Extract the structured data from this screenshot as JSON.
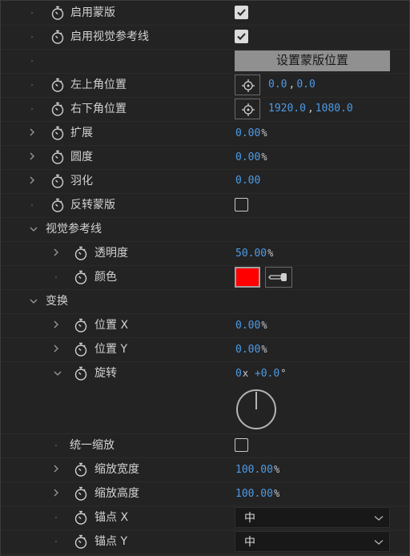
{
  "rows": [
    {
      "label": "启用蒙版",
      "checked": true
    },
    {
      "label": "启用视觉参考线",
      "checked": true
    },
    {
      "button_label": "设置蒙版位置"
    },
    {
      "label": "左上角位置",
      "x": "0.0",
      "y": "0.0"
    },
    {
      "label": "右下角位置",
      "x": "1920.0",
      "y": "1080.0"
    },
    {
      "label": "扩展",
      "value": "0.00",
      "unit": "%"
    },
    {
      "label": "圆度",
      "value": "0.00",
      "unit": "%"
    },
    {
      "label": "羽化",
      "value": "0.00"
    },
    {
      "label": "反转蒙版",
      "checked": false
    },
    {
      "label": "视觉参考线"
    },
    {
      "label": "透明度",
      "value": "50.00",
      "unit": "%"
    },
    {
      "label": "颜色",
      "color": "#ff0000"
    },
    {
      "label": "变换"
    },
    {
      "label": "位置 X",
      "value": "0.00",
      "unit": "%"
    },
    {
      "label": "位置 Y",
      "value": "0.00",
      "unit": "%"
    },
    {
      "label": "旋转",
      "turns": "0",
      "turns_unit": "x",
      "degrees": "+0.0",
      "degrees_unit": "°"
    },
    {
      "label": "统一缩放",
      "checked": false
    },
    {
      "label": "缩放宽度",
      "value": "100.00",
      "unit": "%"
    },
    {
      "label": "缩放高度",
      "value": "100.00",
      "unit": "%"
    },
    {
      "label": "锚点 X",
      "selected": "中"
    },
    {
      "label": "锚点 Y",
      "selected": "中"
    }
  ],
  "icons": {
    "stopwatch": "stopwatch-icon",
    "expand": "chevron-right-icon",
    "collapse": "chevron-down-icon",
    "target": "crosshair-icon",
    "eyedropper": "eyedropper-icon"
  },
  "colors": {
    "value_blue": "#4d9be6",
    "swatch_red": "#ff0000",
    "background": "#232323"
  }
}
